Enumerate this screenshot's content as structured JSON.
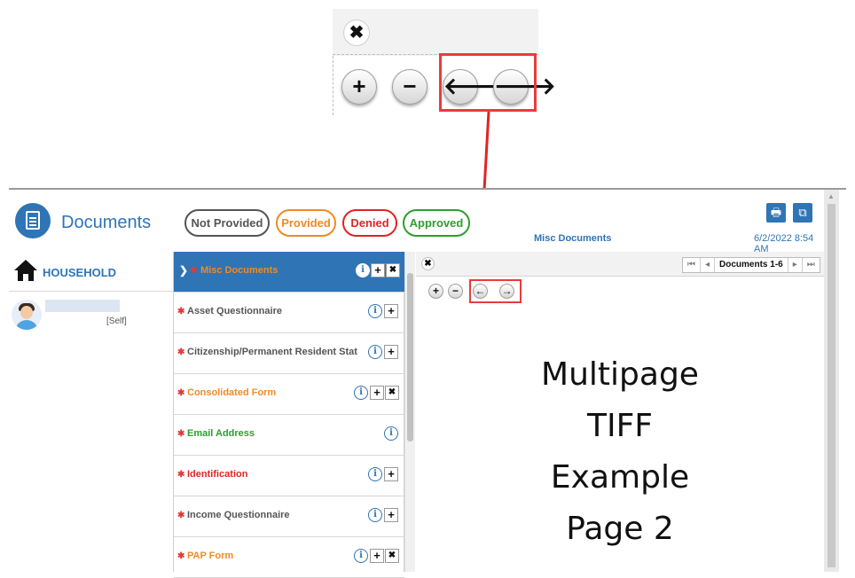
{
  "callout": {
    "close_icon": "✖",
    "buttons": [
      {
        "name": "zoom-in-button",
        "glyph": "+"
      },
      {
        "name": "zoom-out-button",
        "glyph": "−"
      },
      {
        "name": "previous-page-button",
        "glyph": "🡐"
      },
      {
        "name": "next-page-button",
        "glyph": "🡒"
      }
    ],
    "highlight_color": "#ea3b3b"
  },
  "header": {
    "title": "Documents",
    "status_pills": [
      {
        "label": "Not Provided",
        "color": "#555555"
      },
      {
        "label": "Provided",
        "color": "#f08a24"
      },
      {
        "label": "Denied",
        "color": "#e02424"
      },
      {
        "label": "Approved",
        "color": "#2e9e2e"
      }
    ],
    "current_document": "Misc Documents",
    "timestamp": "6/2/2022 8:54 AM",
    "print_icon": "🖶",
    "copy_icon": "⧉",
    "brand_color": "#2f74b5"
  },
  "household": {
    "label": "HOUSEHOLD",
    "member_role": "[Self]"
  },
  "documents": [
    {
      "label": "Misc Documents",
      "color": "#f08a24",
      "active": true,
      "info": true,
      "add": true,
      "remove": true
    },
    {
      "label": "Asset Questionnaire",
      "color": "#555555",
      "active": false,
      "info": true,
      "add": true,
      "remove": false
    },
    {
      "label": "Citizenship/Permanent Resident Stat",
      "color": "#555555",
      "active": false,
      "info": true,
      "add": true,
      "remove": false
    },
    {
      "label": "Consolidated Form",
      "color": "#f08a24",
      "active": false,
      "info": true,
      "add": true,
      "remove": true
    },
    {
      "label": "Email Address",
      "color": "#2e9e2e",
      "active": false,
      "info": true,
      "add": false,
      "remove": false
    },
    {
      "label": "Identification",
      "color": "#e02424",
      "active": false,
      "info": true,
      "add": true,
      "remove": false
    },
    {
      "label": "Income Questionnaire",
      "color": "#555555",
      "active": false,
      "info": true,
      "add": true,
      "remove": false
    },
    {
      "label": "PAP Form",
      "color": "#f08a24",
      "active": false,
      "info": true,
      "add": true,
      "remove": true
    }
  ],
  "viewer": {
    "pager": {
      "first": "⏮",
      "prev": "◂",
      "label": "Documents 1-6",
      "next": "▸",
      "last": "⏭"
    },
    "toolbar": [
      "+",
      "−",
      "←",
      "→"
    ],
    "page_lines": [
      "Multipage",
      "TIFF",
      "Example",
      "Page 2"
    ]
  }
}
